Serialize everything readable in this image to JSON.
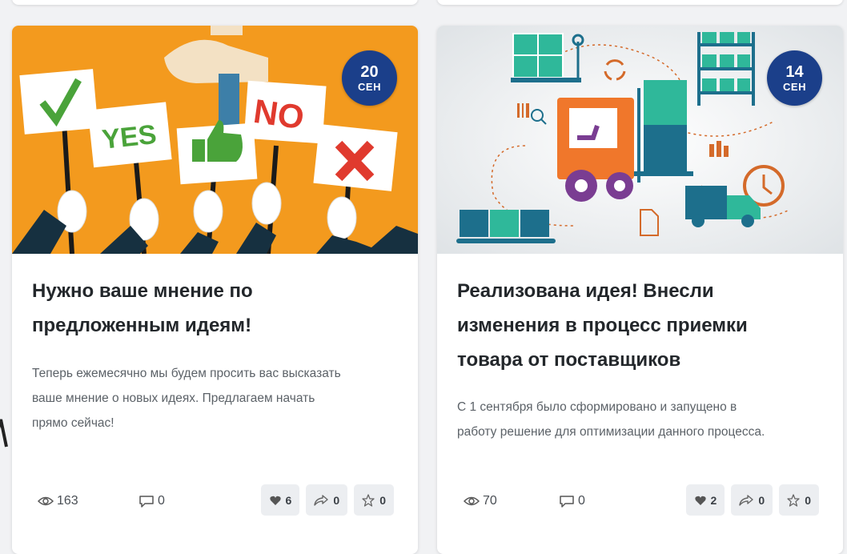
{
  "cards": [
    {
      "date_day": "20",
      "date_month": "СЕН",
      "title_lines": [
        "Нужно ваше мнение по",
        "предложенным идеям!"
      ],
      "text_lines": [
        "Теперь ежемесячно мы будем просить вас высказать",
        "ваше мнение о новых идеях. Предлагаем начать",
        "прямо сейчас!"
      ],
      "image_signs": [
        "YES",
        "NO"
      ],
      "views": "163",
      "comments": "0",
      "likes": "6",
      "shares": "0",
      "favorites": "0"
    },
    {
      "date_day": "14",
      "date_month": "СЕН",
      "title_lines": [
        "Реализована идея! Внесли",
        "изменения в процесс приемки",
        "товара от поставщиков"
      ],
      "text_lines": [
        "С 1 сентября было сформировано и запущено в",
        "работу решение для оптимизации данного процесса."
      ],
      "views": "70",
      "comments": "0",
      "likes": "2",
      "shares": "0",
      "favorites": "0"
    }
  ],
  "colors": {
    "badge": "#1b3f8a",
    "card_1_image_bg": "#f39a1e",
    "card_2_image_bg": "#e9ecee"
  },
  "icons": {
    "views": "eye-icon",
    "comments": "comment-icon",
    "likes": "heart-icon",
    "shares": "share-icon",
    "favorites": "star-icon"
  }
}
